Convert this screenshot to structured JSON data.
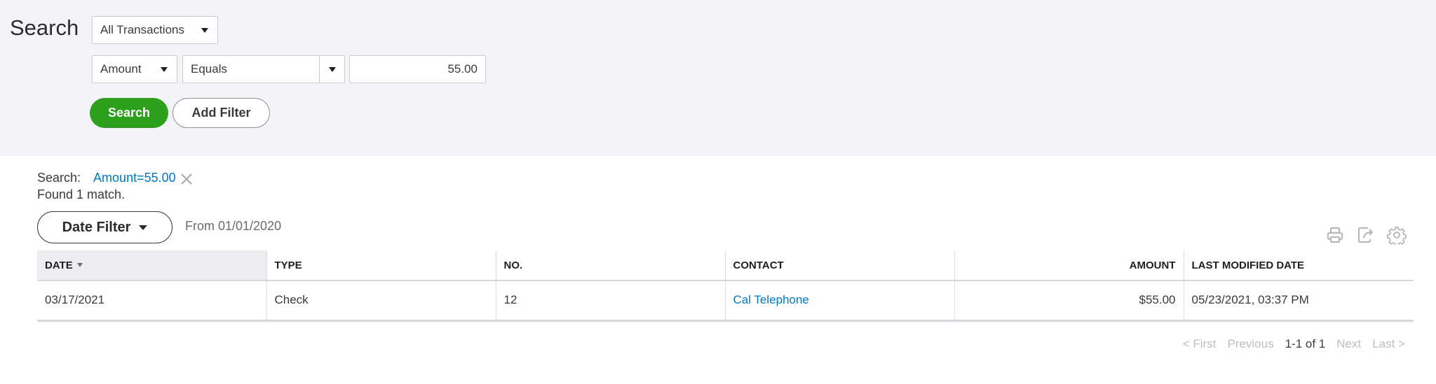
{
  "page": {
    "title": "Search"
  },
  "filters": {
    "transaction_type": "All Transactions",
    "field": "Amount",
    "operator": "Equals",
    "value": "55.00"
  },
  "actions": {
    "search_label": "Search",
    "add_filter_label": "Add Filter"
  },
  "summary": {
    "label": "Search:",
    "chip": "Amount=55.00",
    "found": "Found 1 match."
  },
  "date_filter": {
    "label": "Date Filter",
    "range": "From 01/01/2020"
  },
  "toolbar": {
    "icons": [
      "print-icon",
      "export-icon",
      "settings-gear-icon"
    ]
  },
  "table": {
    "columns": [
      "DATE",
      "TYPE",
      "NO.",
      "CONTACT",
      "AMOUNT",
      "LAST MODIFIED DATE"
    ],
    "sorted_column": "DATE",
    "rows": [
      {
        "date": "03/17/2021",
        "type": "Check",
        "no": "12",
        "contact": "Cal Telephone",
        "amount": "$55.00",
        "last_modified": "05/23/2021, 03:37 PM"
      }
    ]
  },
  "pager": {
    "first": "< First",
    "previous": "Previous",
    "status": "1-1 of 1",
    "next": "Next",
    "last": "Last >"
  },
  "colors": {
    "accent_green": "#2ca01c",
    "link_blue": "#0077c5",
    "panel_bg": "#f3f4f8"
  }
}
